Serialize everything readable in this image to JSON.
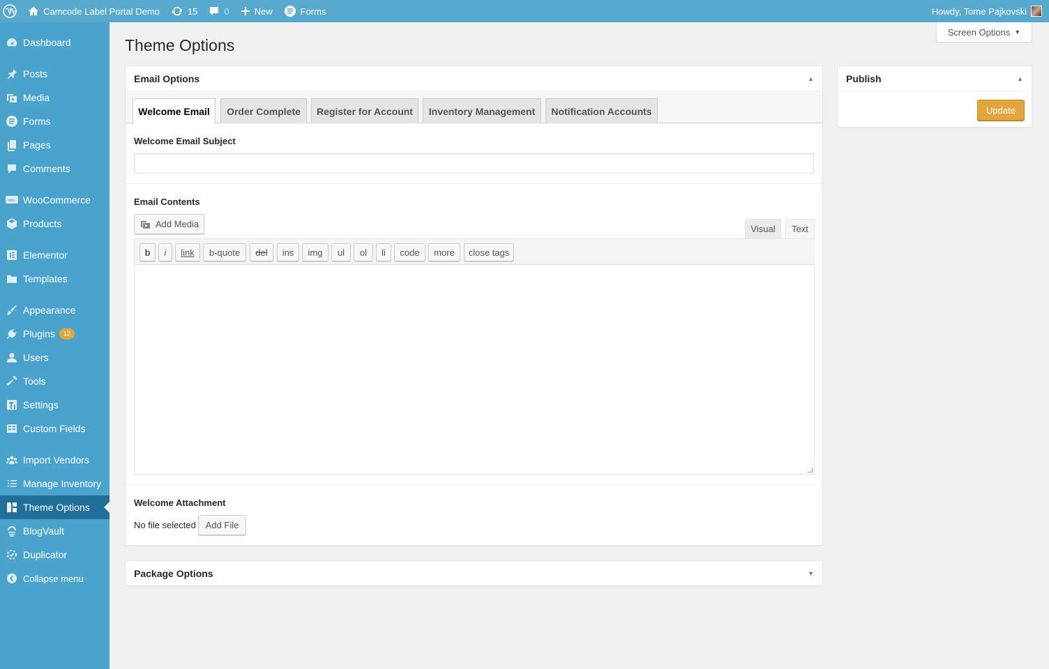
{
  "admin_bar": {
    "wp_logo_icon": "wordpress-logo-icon",
    "site_name": "Camcode Label Portal Demo",
    "updates_count": "15",
    "comments_count": "0",
    "new_label": "New",
    "forms_label": "Forms",
    "greeting": "Howdy, Tome Pajkovski"
  },
  "sidebar": {
    "items": [
      {
        "label": "Dashboard",
        "icon": "dashboard-icon"
      },
      {
        "label": "Posts",
        "icon": "pin-icon"
      },
      {
        "label": "Media",
        "icon": "media-icon"
      },
      {
        "label": "Forms",
        "icon": "forms-icon"
      },
      {
        "label": "Pages",
        "icon": "pages-icon"
      },
      {
        "label": "Comments",
        "icon": "comments-icon"
      },
      {
        "label": "WooCommerce",
        "icon": "woocommerce-icon"
      },
      {
        "label": "Products",
        "icon": "products-icon"
      },
      {
        "label": "Elementor",
        "icon": "elementor-icon"
      },
      {
        "label": "Templates",
        "icon": "folder-icon"
      },
      {
        "label": "Appearance",
        "icon": "brush-icon"
      },
      {
        "label": "Plugins",
        "icon": "plugin-icon",
        "badge": "12"
      },
      {
        "label": "Users",
        "icon": "user-icon"
      },
      {
        "label": "Tools",
        "icon": "wrench-icon"
      },
      {
        "label": "Settings",
        "icon": "settings-icon"
      },
      {
        "label": "Custom Fields",
        "icon": "table-icon"
      },
      {
        "label": "Import Vendors",
        "icon": "groups-icon"
      },
      {
        "label": "Manage Inventory",
        "icon": "list-icon"
      },
      {
        "label": "Theme Options",
        "icon": "layout-icon",
        "current": true
      },
      {
        "label": "BlogVault",
        "icon": "vault-icon"
      },
      {
        "label": "Duplicator",
        "icon": "duplicator-icon"
      },
      {
        "label": "Collapse menu",
        "icon": "collapse-icon"
      }
    ]
  },
  "screen_options_label": "Screen Options",
  "page_title": "Theme Options",
  "email_options": {
    "title": "Email Options",
    "tabs": [
      "Welcome Email",
      "Order Complete",
      "Register for Account",
      "Inventory Management",
      "Notification Accounts"
    ],
    "active_tab": "Welcome Email",
    "subject_label": "Welcome Email Subject",
    "subject_value": "",
    "contents_label": "Email Contents",
    "add_media_label": "Add Media",
    "mode_visual": "Visual",
    "mode_text": "Text",
    "toolbar_buttons": [
      "b",
      "i",
      "link",
      "b-quote",
      "del",
      "ins",
      "img",
      "ul",
      "ol",
      "li",
      "code",
      "more",
      "close tags"
    ],
    "editor_content": "",
    "attachment_label": "Welcome Attachment",
    "file_status": "No file selected",
    "add_file_label": "Add File"
  },
  "package_options": {
    "title": "Package Options"
  },
  "publish": {
    "title": "Publish",
    "update_label": "Update"
  },
  "colors": {
    "admin_bar": "#57a9cd",
    "sidebar": "#4aa3cc",
    "sidebar_current": "#1f6f99",
    "update_button": "#e3a53e",
    "badge": "#e2a43b"
  }
}
